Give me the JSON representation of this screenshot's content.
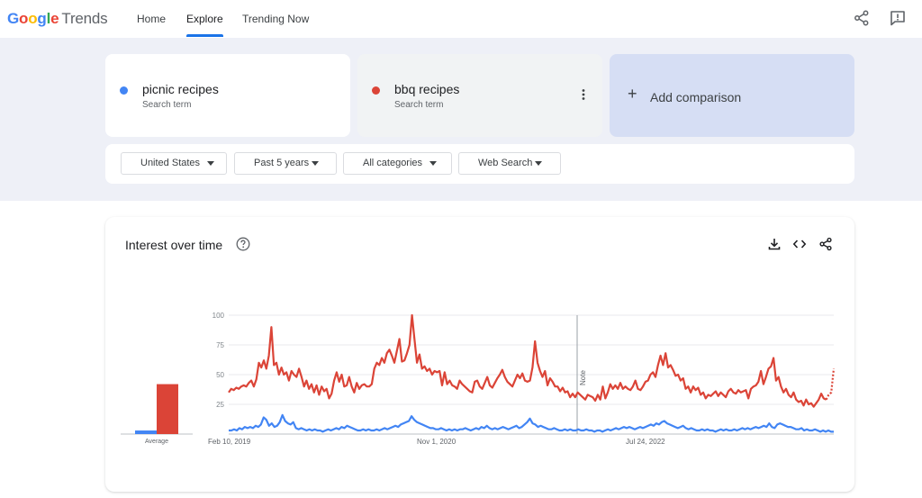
{
  "app": {
    "logo_google": "Google",
    "logo_trends": "Trends"
  },
  "nav": {
    "home": "Home",
    "explore": "Explore",
    "trending_now": "Trending Now"
  },
  "terms": [
    {
      "name": "picnic recipes",
      "subtitle": "Search term",
      "color": "#4285f4"
    },
    {
      "name": "bbq recipes",
      "subtitle": "Search term",
      "color": "#db4437"
    }
  ],
  "add_comparison": {
    "label": "Add comparison"
  },
  "filters": {
    "region": "United States",
    "time": "Past 5 years",
    "category": "All categories",
    "search_type": "Web Search"
  },
  "card": {
    "title": "Interest over time"
  },
  "chart_data": {
    "type": "line",
    "x_ticks": [
      "Feb 10, 2019",
      "Nov 1, 2020",
      "Jul 24, 2022"
    ],
    "ylim": [
      0,
      100
    ],
    "y_ticks": [
      "100",
      "75",
      "50",
      "25"
    ],
    "annotation": "Note",
    "averages": {
      "label": "Average",
      "values": [
        3,
        42
      ]
    },
    "series": [
      {
        "term": "picnic recipes",
        "color": "#4285f4",
        "values": [
          3,
          3,
          4,
          3,
          5,
          4,
          6,
          5,
          6,
          5,
          7,
          6,
          8,
          14,
          12,
          7,
          9,
          6,
          7,
          10,
          16,
          11,
          9,
          8,
          10,
          5,
          4,
          5,
          4,
          3,
          4,
          3,
          4,
          3,
          3,
          2,
          3,
          4,
          3,
          4,
          5,
          4,
          6,
          5,
          7,
          6,
          5,
          4,
          3,
          3,
          4,
          3,
          4,
          3,
          3,
          4,
          3,
          4,
          5,
          4,
          5,
          6,
          7,
          6,
          8,
          9,
          10,
          11,
          15,
          12,
          10,
          9,
          8,
          7,
          6,
          5,
          5,
          4,
          4,
          5,
          4,
          3,
          4,
          3,
          4,
          3,
          4,
          4,
          5,
          4,
          3,
          4,
          5,
          4,
          6,
          5,
          7,
          5,
          4,
          5,
          4,
          5,
          6,
          5,
          4,
          5,
          6,
          7,
          5,
          6,
          8,
          10,
          13,
          9,
          8,
          6,
          7,
          6,
          5,
          4,
          4,
          5,
          4,
          3,
          3,
          4,
          3,
          4,
          3,
          3,
          4,
          3,
          3,
          4,
          3,
          3,
          2,
          3,
          3,
          2,
          3,
          4,
          3,
          4,
          5,
          4,
          5,
          6,
          5,
          6,
          5,
          4,
          5,
          6,
          5,
          6,
          7,
          8,
          7,
          9,
          8,
          10,
          11,
          9,
          8,
          7,
          6,
          5,
          6,
          7,
          5,
          4,
          5,
          4,
          3,
          3,
          4,
          3,
          4,
          3,
          3,
          2,
          3,
          4,
          3,
          4,
          3,
          3,
          4,
          3,
          4,
          5,
          4,
          5,
          4,
          5,
          6,
          5,
          6,
          7,
          6,
          9,
          6,
          5,
          8,
          9,
          8,
          7,
          6,
          6,
          5,
          4,
          4,
          5,
          3,
          4,
          3,
          3,
          4,
          3,
          2,
          3,
          2,
          3,
          2,
          2
        ],
        "dashed_tail": false
      },
      {
        "term": "bbq recipes",
        "color": "#db4437",
        "values": [
          35,
          38,
          37,
          39,
          38,
          40,
          41,
          40,
          43,
          45,
          40,
          46,
          60,
          56,
          62,
          55,
          66,
          90,
          58,
          60,
          50,
          56,
          50,
          52,
          45,
          53,
          50,
          48,
          55,
          48,
          40,
          45,
          38,
          42,
          35,
          41,
          33,
          40,
          36,
          38,
          30,
          34,
          45,
          52,
          44,
          50,
          40,
          41,
          48,
          40,
          35,
          43,
          38,
          41,
          42,
          40,
          40,
          42,
          55,
          60,
          58,
          64,
          60,
          68,
          71,
          66,
          60,
          70,
          80,
          61,
          62,
          68,
          75,
          100,
          80,
          60,
          67,
          55,
          57,
          53,
          55,
          50,
          53,
          52,
          53,
          41,
          52,
          42,
          45,
          41,
          40,
          38,
          45,
          42,
          40,
          38,
          36,
          35,
          44,
          45,
          40,
          38,
          43,
          48,
          41,
          39,
          43,
          47,
          50,
          54,
          48,
          44,
          42,
          40,
          45,
          50,
          47,
          51,
          45,
          44,
          45,
          56,
          78,
          60,
          53,
          48,
          53,
          41,
          47,
          44,
          40,
          40,
          36,
          39,
          35,
          36,
          31,
          34,
          31,
          35,
          33,
          31,
          29,
          33,
          32,
          31,
          28,
          33,
          29,
          40,
          30,
          35,
          42,
          38,
          41,
          38,
          43,
          38,
          40,
          38,
          37,
          40,
          45,
          38,
          37,
          40,
          44,
          45,
          50,
          52,
          48,
          58,
          66,
          58,
          68,
          56,
          58,
          54,
          49,
          50,
          45,
          47,
          38,
          40,
          35,
          40,
          37,
          39,
          33,
          35,
          30,
          33,
          32,
          34,
          36,
          32,
          35,
          33,
          31,
          36,
          38,
          35,
          34,
          37,
          35,
          36,
          37,
          30,
          38,
          40,
          41,
          44,
          53,
          42,
          48,
          55,
          57,
          64,
          45,
          48,
          40,
          35,
          38,
          33,
          31,
          35,
          29,
          27,
          28,
          24,
          29,
          25,
          26,
          23,
          26,
          29,
          34,
          30,
          29,
          33,
          35,
          55
        ],
        "dashed_tail": true
      }
    ]
  }
}
